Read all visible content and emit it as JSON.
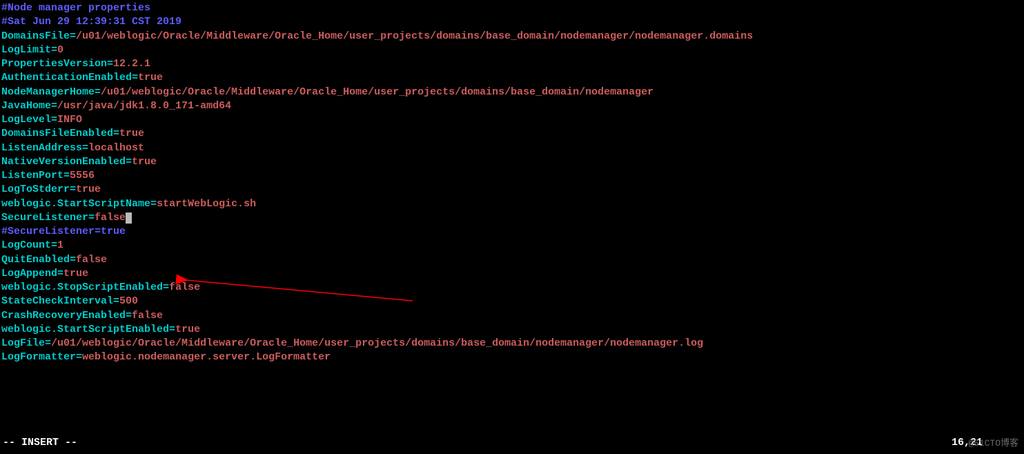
{
  "comments": {
    "c1": "#Node manager properties",
    "c2": "#Sat Jun 29 12:39:31 CST 2019",
    "c3": "#SecureListener=true"
  },
  "props": [
    {
      "k": "DomainsFile",
      "v": "/u01/weblogic/Oracle/Middleware/Oracle_Home/user_projects/domains/base_domain/nodemanager/nodemanager.domains"
    },
    {
      "k": "LogLimit",
      "v": "0"
    },
    {
      "k": "PropertiesVersion",
      "v": "12.2.1"
    },
    {
      "k": "AuthenticationEnabled",
      "v": "true"
    },
    {
      "k": "NodeManagerHome",
      "v": "/u01/weblogic/Oracle/Middleware/Oracle_Home/user_projects/domains/base_domain/nodemanager"
    },
    {
      "k": "JavaHome",
      "v": "/usr/java/jdk1.8.0_171-amd64"
    },
    {
      "k": "LogLevel",
      "v": "INFO"
    },
    {
      "k": "DomainsFileEnabled",
      "v": "true"
    },
    {
      "k": "ListenAddress",
      "v": "localhost"
    },
    {
      "k": "NativeVersionEnabled",
      "v": "true"
    },
    {
      "k": "ListenPort",
      "v": "5556"
    },
    {
      "k": "LogToStderr",
      "v": "true"
    },
    {
      "k": "weblogic.StartScriptName",
      "v": "startWebLogic.sh"
    },
    {
      "k": "SecureListener",
      "v": "false"
    }
  ],
  "props2": [
    {
      "k": "LogCount",
      "v": "1"
    },
    {
      "k": "QuitEnabled",
      "v": "false"
    },
    {
      "k": "LogAppend",
      "v": "true"
    },
    {
      "k": "weblogic.StopScriptEnabled",
      "v": "false"
    },
    {
      "k": "StateCheckInterval",
      "v": "500"
    },
    {
      "k": "CrashRecoveryEnabled",
      "v": "false"
    },
    {
      "k": "weblogic.StartScriptEnabled",
      "v": "true"
    },
    {
      "k": "LogFile",
      "v": "/u01/weblogic/Oracle/Middleware/Oracle_Home/user_projects/domains/base_domain/nodemanager/nodemanager.log"
    },
    {
      "k": "LogFormatter",
      "v": "weblogic.nodemanager.server.LogFormatter"
    }
  ],
  "status": {
    "mode": "-- INSERT --",
    "pos": "16,21"
  },
  "watermark": "@51CTO博客"
}
